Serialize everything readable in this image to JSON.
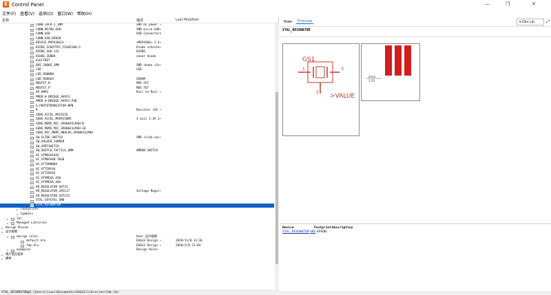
{
  "window": {
    "title": "Control Panel",
    "app_logo": "E",
    "minimize": "—",
    "maximize": "❐",
    "close": "✕"
  },
  "menu": [
    "文件(F)",
    "查看(V)",
    "选项(O)",
    "窗口(W)",
    "帮助(H)"
  ],
  "columns": {
    "name": "名称",
    "description": "描述",
    "last_modified": "Last Modified"
  },
  "tree": [
    {
      "label": "CONN_JACK-2_1MM",
      "desc": "SMD DC power ~",
      "lvl": 3
    },
    {
      "label": "CONN_MICRO-USB",
      "desc": "SMD micro USB~",
      "lvl": 3
    },
    {
      "label": "CONN_USB",
      "desc": "USB Connectors",
      "lvl": 3
    },
    {
      "label": "CONN_USB_MINIB",
      "desc": "",
      "lvl": 3
    },
    {
      "label": "DEVICE_MSP430G2+",
      "desc": "+MSP430G+ 2.4~",
      "lvl": 3
    },
    {
      "label": "DIODE_SCHOTTKY_CUS03100-G",
      "desc": "Diode schottk~",
      "lvl": 3
    },
    {
      "label": "DIODE_SOD-123",
      "desc": "DIODE",
      "lvl": 3
    },
    {
      "label": "DIODE_ZENER",
      "desc": "zener diode",
      "lvl": 3
    },
    {
      "label": "ELECTRET",
      "desc": "",
      "lvl": 3
    },
    {
      "label": "EMI_CHOKE_1MM",
      "desc": "SMD choke (Ce~",
      "lvl": 3
    },
    {
      "label": "LED",
      "desc": "LED",
      "lvl": 3
    },
    {
      "label": "LED_RGBNEW",
      "desc": "",
      "lvl": 3
    },
    {
      "label": "LED_RGBOLD",
      "desc": "OSRAM",
      "lvl": 3
    },
    {
      "label": "MOSFET_N",
      "desc": "MOS FET",
      "lvl": 3
    },
    {
      "label": "MOSFET_P",
      "desc": "MOS FET",
      "lvl": 3
    },
    {
      "label": "OP_AMP4",
      "desc": "Rail-to-Rail ~",
      "lvl": 3
    },
    {
      "label": "PMOD_H-BRIDGE_AA953",
      "desc": "",
      "lvl": 3
    },
    {
      "label": "PMOD_H-BRIDGE_AA953_PAD",
      "desc": "",
      "lvl": 3
    },
    {
      "label": "Q_PHOTOTRANSISTOR-NPN",
      "desc": "",
      "lvl": 3
    },
    {
      "label": "R",
      "desc": "Resistor (US ~",
      "lvl": 3
    },
    {
      "label": "SENS_ACCEL_MXC6226",
      "desc": "",
      "lvl": 3
    },
    {
      "label": "SENS_ACCEL_MXR9150MZ",
      "desc": "3-axis 3.3V a~",
      "lvl": 3
    },
    {
      "label": "SENS_MEMS_MIC_SPH0645LM4H-B",
      "desc": "",
      "lvl": 3
    },
    {
      "label": "SENS_MEMS_MIC_SPH0641LM4H-1B",
      "desc": "",
      "lvl": 3
    },
    {
      "label": "SENS_MIC_MEMS_ANALOG_SPH0641LM4H",
      "desc": "",
      "lvl": 3
    },
    {
      "label": "SW_SLIDE-SWITCH",
      "desc": "SMD slide-swi~",
      "lvl": 3
    },
    {
      "label": "SW_SOLDER_JUMPER",
      "desc": "",
      "lvl": 3
    },
    {
      "label": "SW_SPDTSWITCH",
      "desc": "",
      "lvl": 3
    },
    {
      "label": "SW_SWITCH_TACTILE_6MM",
      "desc": "OMRON SWITCH",
      "lvl": 3
    },
    {
      "label": "UC_ATMEGA16U2",
      "desc": "",
      "lvl": 3
    },
    {
      "label": "UC_ATMEGA48-TKG8",
      "desc": "",
      "lvl": 3
    },
    {
      "label": "UC_ATTAMAN8A",
      "desc": "",
      "lvl": 3
    },
    {
      "label": "UC_ATTINY44",
      "desc": "",
      "lvl": 3
    },
    {
      "label": "UC_ATTINY45",
      "desc": "",
      "lvl": 3
    },
    {
      "label": "UC_ATXMEGA_A3U",
      "desc": "",
      "lvl": 3
    },
    {
      "label": "UC_ATXMEGA_A4U",
      "desc": "",
      "lvl": 3
    },
    {
      "label": "VR_REGULATOR-SOT23",
      "desc": "",
      "lvl": 3
    },
    {
      "label": "VR_REGULATOR_LM1117",
      "desc": "Voltage Regul~",
      "lvl": 3
    },
    {
      "label": "VR_REGULATOR_SOT223",
      "desc": "",
      "lvl": 3
    },
    {
      "label": "XTAL_CRYSTAL_SMD",
      "desc": "",
      "lvl": 3
    },
    {
      "label": "XTAL_RESONATOR",
      "desc": "",
      "lvl": 3,
      "sel": true
    },
    {
      "label": "Footprints",
      "desc": "",
      "lvl": 2,
      "exp": "▸"
    },
    {
      "label": "Symbols",
      "desc": "",
      "lvl": 2,
      "exp": "▸"
    },
    {
      "label": "lbr",
      "desc": "",
      "lvl": 1,
      "exp": "▸",
      "icon": true
    },
    {
      "label": "Managed Libraries",
      "desc": "",
      "lvl": 1,
      "exp": "▸",
      "icon": true
    },
    {
      "label": "Design Blocks",
      "desc": "",
      "lvl": 0,
      "exp": "▸"
    },
    {
      "label": "设计规则",
      "desc": "",
      "lvl": 0,
      "exp": "▾"
    },
    {
      "label": "design rules",
      "desc": "User 设计规则",
      "lvl": 1,
      "exp": "▾",
      "icon": true
    },
    {
      "label": "default.dru",
      "desc": "EAGLE Design ~",
      "mod": "2019/11/8 13:36",
      "lvl": 2,
      "icon": true
    },
    {
      "label": "fab.dru",
      "desc": "EAGLE Design ~",
      "mod": "2020/3/8 21:04",
      "lvl": 2,
      "icon": true
    },
    {
      "label": "examples",
      "desc": "Design Rules",
      "lvl": 1,
      "exp": "▸",
      "icon": true
    },
    {
      "label": "用户语言程序",
      "desc": "",
      "lvl": 0,
      "exp": "▸"
    },
    {
      "label": "脚本",
      "desc": "",
      "lvl": 0,
      "exp": "▸"
    }
  ],
  "preview": {
    "tab_home": "Home",
    "tab_preview": "Preview",
    "library_dropdown": "Ziba Lib",
    "expand_btn": "⤢",
    "device_name": "XTAL_RESONATOR",
    "symbol_name": "GS1",
    "symbol_value": ">VALUE",
    "pin1": "1",
    "pin2": "2",
    "pin3": "3",
    "pkg_dim_1": "2mm",
    "pkg_dim_2": "3.20"
  },
  "variants": {
    "headers": [
      "Device",
      "Footprint",
      "Description"
    ],
    "device": "XTAL_RESONATOR",
    "footprint": "ABS",
    "description": "EPSON"
  },
  "status": {
    "path": "XTAL_RESONATOR@C:\\Users\\liuzi\\Documents\\EAGLE\\libraries\\fab.lbr"
  },
  "colors": {
    "selection": "#0a64c8",
    "symbol": "#c0392b",
    "pad": "#e02020"
  }
}
